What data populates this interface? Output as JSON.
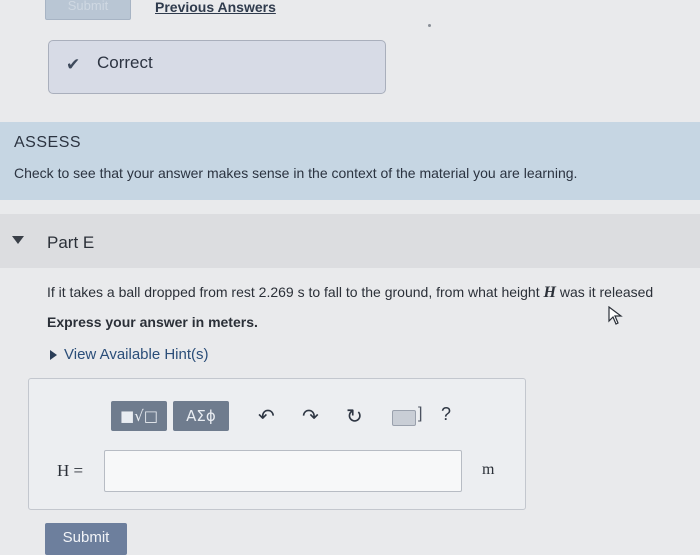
{
  "top": {
    "submit_label": "Submit",
    "previous_answers_label": "Previous Answers"
  },
  "feedback": {
    "icon": "check-icon",
    "status_text": "Correct"
  },
  "assess": {
    "title": "ASSESS",
    "text": "Check to see that your answer makes sense in the context of the material you are learning."
  },
  "part_e": {
    "title": "Part E",
    "question_prefix": "If it takes a ball dropped from rest 2.269 s to fall to the ground, from what height ",
    "question_var": "H",
    "question_suffix": " was it released",
    "instruction": "Express your answer in meters.",
    "hint_link": "View Available Hint(s)"
  },
  "toolbar": {
    "math_template_label": "■√□",
    "greek_label": "ΑΣϕ",
    "undo_icon": "undo-icon",
    "redo_icon": "redo-icon",
    "reset_icon": "reset-icon",
    "keyboard_icon": "keyboard-icon",
    "keyboard_suffix": "]",
    "help_label": "?"
  },
  "answer": {
    "variable_label": "H =",
    "value": "",
    "unit": "m"
  },
  "bottom": {
    "submit_label": "Submit"
  },
  "colors": {
    "assess_band": "#c6d6e3",
    "submit_button": "#6d7f9d",
    "link": "#2b4e79"
  }
}
